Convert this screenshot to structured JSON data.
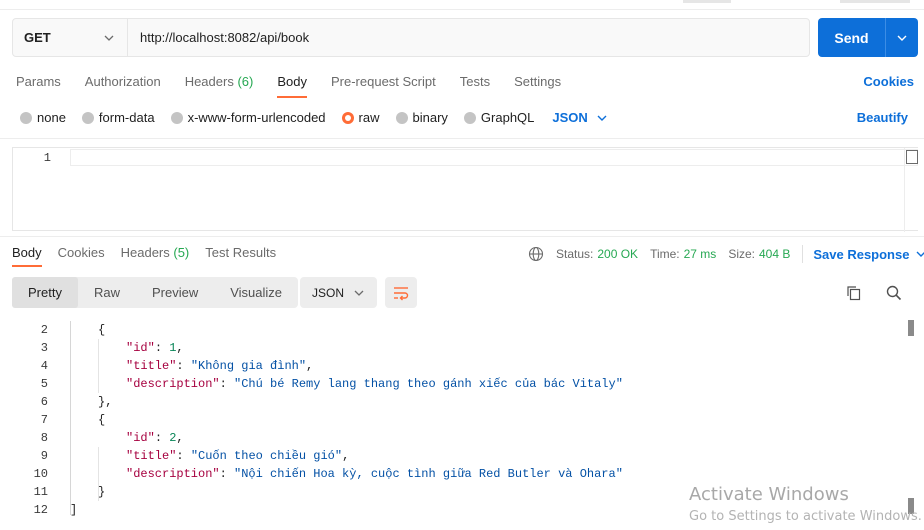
{
  "request": {
    "method": "GET",
    "url": "http://localhost:8082/api/book",
    "send_label": "Send"
  },
  "request_tabs": [
    {
      "label": "Params"
    },
    {
      "label": "Authorization"
    },
    {
      "label": "Headers",
      "count": "(6)"
    },
    {
      "label": "Body",
      "active": true
    },
    {
      "label": "Pre-request Script"
    },
    {
      "label": "Tests"
    },
    {
      "label": "Settings"
    }
  ],
  "cookies_label": "Cookies",
  "body_types": [
    {
      "label": "none"
    },
    {
      "label": "form-data"
    },
    {
      "label": "x-www-form-urlencoded"
    },
    {
      "label": "raw",
      "selected": true
    },
    {
      "label": "binary"
    },
    {
      "label": "GraphQL"
    }
  ],
  "body_language": "JSON",
  "beautify_label": "Beautify",
  "request_editor": {
    "line_number": "1"
  },
  "response_tabs": [
    {
      "label": "Body",
      "active": true
    },
    {
      "label": "Cookies"
    },
    {
      "label": "Headers",
      "count": "(5)"
    },
    {
      "label": "Test Results"
    }
  ],
  "response_meta": {
    "status_label": "Status:",
    "status_value": "200 OK",
    "time_label": "Time:",
    "time_value": "27 ms",
    "size_label": "Size:",
    "size_value": "404 B",
    "save_label": "Save Response"
  },
  "view_modes": [
    {
      "label": "Pretty",
      "active": true
    },
    {
      "label": "Raw"
    },
    {
      "label": "Preview"
    },
    {
      "label": "Visualize"
    }
  ],
  "response_format": "JSON",
  "response_lines": [
    {
      "n": "2",
      "indent": 0,
      "tokens": [
        {
          "t": "{",
          "c": ""
        }
      ]
    },
    {
      "n": "3",
      "indent": 1,
      "tokens": [
        {
          "t": "\"id\"",
          "c": "k-str"
        },
        {
          "t": ": ",
          "c": ""
        },
        {
          "t": "1",
          "c": "v-num"
        },
        {
          "t": ",",
          "c": ""
        }
      ]
    },
    {
      "n": "4",
      "indent": 1,
      "tokens": [
        {
          "t": "\"title\"",
          "c": "k-str"
        },
        {
          "t": ": ",
          "c": ""
        },
        {
          "t": "\"Không gia đình\"",
          "c": "v-str"
        },
        {
          "t": ",",
          "c": ""
        }
      ]
    },
    {
      "n": "5",
      "indent": 1,
      "tokens": [
        {
          "t": "\"description\"",
          "c": "k-str"
        },
        {
          "t": ": ",
          "c": ""
        },
        {
          "t": "\"Chú bé Remy lang thang theo gánh xiếc của bác Vitaly\"",
          "c": "v-str"
        }
      ]
    },
    {
      "n": "6",
      "indent": 0,
      "tokens": [
        {
          "t": "},",
          "c": ""
        }
      ]
    },
    {
      "n": "7",
      "indent": 0,
      "tokens": [
        {
          "t": "{",
          "c": ""
        }
      ]
    },
    {
      "n": "8",
      "indent": 1,
      "tokens": [
        {
          "t": "\"id\"",
          "c": "k-str"
        },
        {
          "t": ": ",
          "c": ""
        },
        {
          "t": "2",
          "c": "v-num"
        },
        {
          "t": ",",
          "c": ""
        }
      ]
    },
    {
      "n": "9",
      "indent": 1,
      "tokens": [
        {
          "t": "\"title\"",
          "c": "k-str"
        },
        {
          "t": ": ",
          "c": ""
        },
        {
          "t": "\"Cuốn theo chiều gió\"",
          "c": "v-str"
        },
        {
          "t": ",",
          "c": ""
        }
      ]
    },
    {
      "n": "10",
      "indent": 1,
      "tokens": [
        {
          "t": "\"description\"",
          "c": "k-str"
        },
        {
          "t": ": ",
          "c": ""
        },
        {
          "t": "\"Nội chiến Hoa kỳ, cuộc tình giữa Red Butler và Ohara\"",
          "c": "v-str"
        }
      ]
    },
    {
      "n": "11",
      "indent": 0,
      "tokens": [
        {
          "t": "}",
          "c": ""
        }
      ]
    },
    {
      "n": "12",
      "indent": -1,
      "tokens": [
        {
          "t": "]",
          "c": ""
        }
      ]
    }
  ],
  "watermark": {
    "line1": "Activate Windows",
    "line2": "Go to Settings to activate Windows."
  },
  "colors": {
    "accent": "#ff6c37",
    "primary": "#0d6fd9",
    "success": "#26a852"
  },
  "icons": [
    "chevron-down-icon",
    "globe-icon",
    "wrap-lines-icon",
    "copy-icon",
    "search-icon"
  ]
}
